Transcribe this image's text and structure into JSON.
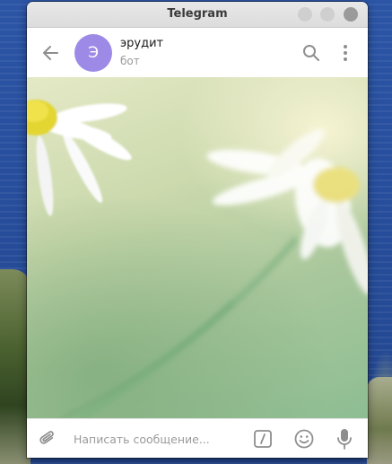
{
  "window": {
    "title": "Telegram"
  },
  "header": {
    "back_icon": "arrow-left-icon",
    "avatar_letter": "Э",
    "avatar_color": "#9d8ae6",
    "chat_name": "эрудит",
    "chat_status": "бот",
    "search_icon": "search-icon",
    "more_icon": "more-vertical-icon"
  },
  "composer": {
    "placeholder": "Написать сообщение...",
    "value": "",
    "attach_icon": "paperclip-icon",
    "commands_icon": "bot-commands-icon",
    "emoji_icon": "emoji-icon",
    "voice_icon": "microphone-icon"
  },
  "colors": {
    "accent": "#9d8ae6",
    "icon": "#8e8e8e"
  }
}
